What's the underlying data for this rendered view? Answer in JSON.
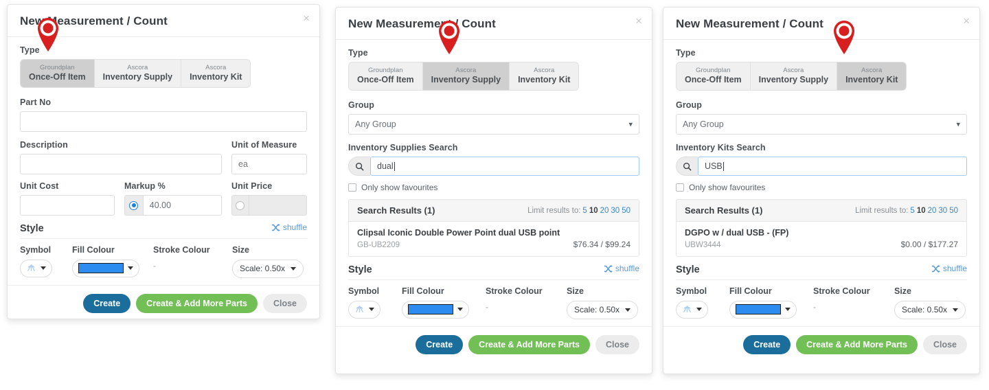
{
  "common": {
    "modal_title": "New Measurement / Count",
    "close_icon": "close-icon",
    "type_label": "Type",
    "tabs": [
      {
        "top": "Groundplan",
        "main": "Once-Off Item"
      },
      {
        "top": "Ascora",
        "main": "Inventory Supply"
      },
      {
        "top": "Ascora",
        "main": "Inventory Kit"
      }
    ],
    "style": {
      "title": "Style",
      "shuffle_label": "shuffle",
      "symbol_label": "Symbol",
      "fill_label": "Fill Colour",
      "stroke_label": "Stroke Colour",
      "stroke_value": "-",
      "size_label": "Size",
      "size_value": "Scale: 0.50x",
      "fill_colour_hex": "#2d8cf0",
      "link_colour_hex": "#5b9bd5"
    },
    "footer": {
      "create": "Create",
      "create_add_more": "Create & Add More Parts",
      "close": "Close",
      "create_colour_hex": "#1b6e9c",
      "create_more_colour_hex": "#72bf56"
    },
    "limit": {
      "prefix": "Limit results to:",
      "options": [
        "5",
        "10",
        "20",
        "30",
        "50"
      ],
      "active": "10"
    },
    "favourites_label": "Only show favourites",
    "group_label": "Group",
    "group_value": "Any Group",
    "marker_colour_hex": "#d81f1f"
  },
  "panel1": {
    "active_tab_index": 0,
    "part_no": {
      "label": "Part No",
      "value": "",
      "placeholder": ""
    },
    "description": {
      "label": "Description",
      "value": "",
      "placeholder": ""
    },
    "unit_of_measure": {
      "label": "Unit of Measure",
      "value": "",
      "placeholder": "ea"
    },
    "unit_cost": {
      "label": "Unit Cost",
      "value": "",
      "placeholder": ""
    },
    "markup": {
      "label": "Markup %",
      "value": "40.00",
      "selected": true
    },
    "unit_price": {
      "label": "Unit Price",
      "value": "",
      "selected": false,
      "disabled": true
    }
  },
  "panel2": {
    "active_tab_index": 1,
    "search": {
      "label": "Inventory Supplies Search",
      "value": "dual",
      "icon": "search-icon"
    },
    "results": {
      "title": "Search Results (1)",
      "items": [
        {
          "name": "Clipsal Iconic Double Power Point dual USB point",
          "code": "GB-UB2209",
          "price": "$76.34 / $99.24"
        }
      ]
    }
  },
  "panel3": {
    "active_tab_index": 2,
    "search": {
      "label": "Inventory Kits Search",
      "value": "USB",
      "icon": "search-icon"
    },
    "results": {
      "title": "Search Results (1)",
      "items": [
        {
          "name": "DGPO w / dual USB - (FP)",
          "code": "UBW3444",
          "price": "$0.00 / $177.27"
        }
      ]
    }
  }
}
